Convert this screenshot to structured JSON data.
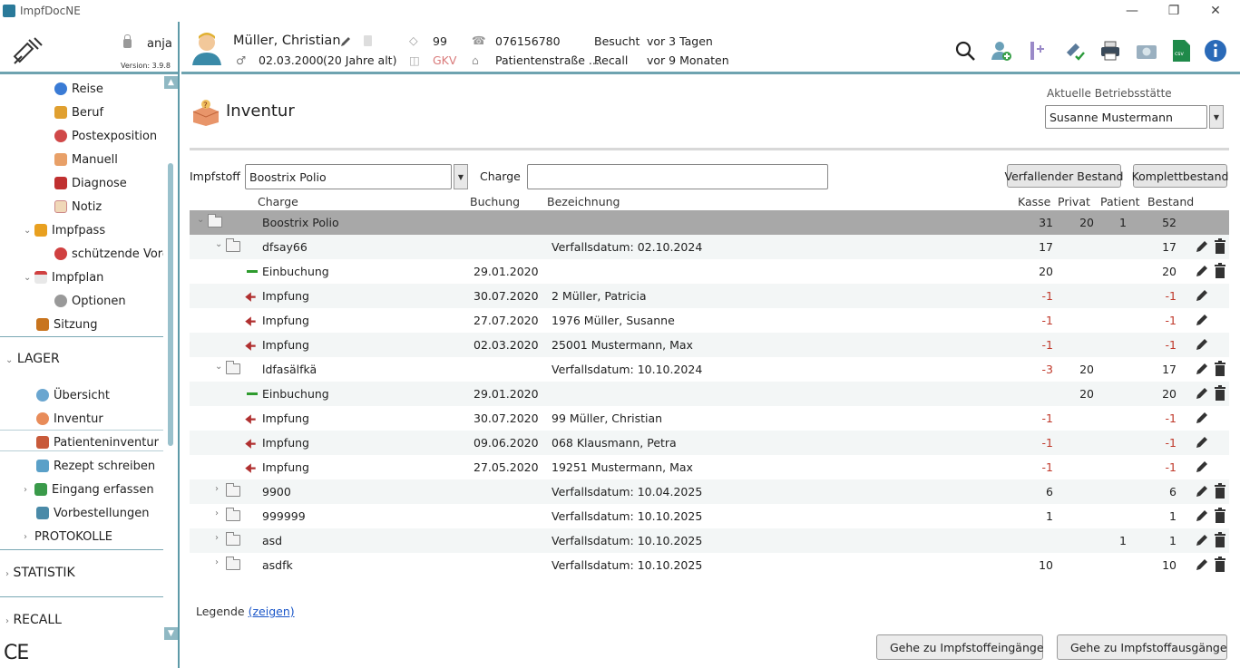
{
  "window": {
    "title": "ImpfDocNE"
  },
  "sidebar": {
    "user": "anja",
    "version": "Version: 3.9.8",
    "items": [
      {
        "label": "Reise",
        "icon": "globe-icon"
      },
      {
        "label": "Beruf",
        "icon": "tools-icon"
      },
      {
        "label": "Postexposition",
        "icon": "alert-icon"
      },
      {
        "label": "Manuell",
        "icon": "hand-icon"
      },
      {
        "label": "Diagnose",
        "icon": "book-icon"
      },
      {
        "label": "Notiz",
        "icon": "note-icon"
      },
      {
        "label": "Impfpass",
        "icon": "passport-icon"
      },
      {
        "label": "schützende Vorer",
        "icon": "heart-icon"
      },
      {
        "label": "Impfplan",
        "icon": "calendar-icon"
      },
      {
        "label": "Optionen",
        "icon": "gear-icon"
      },
      {
        "label": "Sitzung",
        "icon": "briefcase-icon"
      }
    ],
    "lager_label": "LAGER",
    "lager_items": [
      {
        "label": "Übersicht",
        "icon": "overview-icon"
      },
      {
        "label": "Inventur",
        "icon": "inventory-icon"
      },
      {
        "label": "Patienteninventur",
        "icon": "patients-icon"
      },
      {
        "label": "Rezept schreiben",
        "icon": "prescription-icon"
      },
      {
        "label": "Eingang erfassen",
        "icon": "inbox-icon"
      },
      {
        "label": "Vorbestellungen",
        "icon": "preorder-icon"
      }
    ],
    "protokolle_label": "PROTOKOLLE",
    "statistik_label": "STATISTIK",
    "recall_label": "RECALL",
    "ce_label": "CE"
  },
  "patient": {
    "name": "Müller, Christian",
    "birth": "02.03.2000",
    "age": "(20 Jahre alt)",
    "id": "99",
    "insurance": "GKV",
    "phone": "076156780",
    "address": "Patientenstraße ...",
    "besucht_label": "Besucht",
    "besucht_value": "vor 3 Tagen",
    "recall_label": "Recall",
    "recall_value": "vor 9 Monaten"
  },
  "page": {
    "title": "Inventur",
    "betriebsstaette_label": "Aktuelle Betriebsstätte",
    "betriebsstaette_value": "Susanne Mustermann"
  },
  "filters": {
    "impfstoff_label": "Impfstoff",
    "impfstoff_value": "Boostrix Polio",
    "charge_label": "Charge",
    "charge_value": "",
    "btn_verfallend": "Verfallender Bestand",
    "btn_komplett": "Komplettbestand"
  },
  "table": {
    "headers": {
      "charge": "Charge",
      "buchung": "Buchung",
      "bezeichnung": "Bezeichnung",
      "kasse": "Kasse",
      "privat": "Privat",
      "patient": "Patient",
      "bestand": "Bestand"
    },
    "rows": [
      {
        "kind": "group",
        "level": 0,
        "label": "Boostrix Polio",
        "buchung": "",
        "bez": "",
        "kasse": "31",
        "privat": "20",
        "patient": "1",
        "bestand": "52",
        "edit": false,
        "del": false
      },
      {
        "kind": "folder",
        "level": 1,
        "open": true,
        "label": "dfsay66",
        "buchung": "",
        "bez": "Verfallsdatum: 02.10.2024",
        "kasse": "17",
        "privat": "",
        "patient": "",
        "bestand": "17",
        "edit": true,
        "del": true
      },
      {
        "kind": "in",
        "level": 2,
        "label": "Einbuchung",
        "buchung": "29.01.2020",
        "bez": "",
        "kasse": "20",
        "privat": "",
        "patient": "",
        "bestand": "20",
        "edit": true,
        "del": true
      },
      {
        "kind": "out",
        "level": 2,
        "label": "Impfung",
        "buchung": "30.07.2020",
        "bez": "2 Müller, Patricia",
        "kasse": "-1",
        "privat": "",
        "patient": "",
        "bestand": "-1",
        "edit": true,
        "del": false
      },
      {
        "kind": "out",
        "level": 2,
        "label": "Impfung",
        "buchung": "27.07.2020",
        "bez": "1976 Müller, Susanne",
        "kasse": "-1",
        "privat": "",
        "patient": "",
        "bestand": "-1",
        "edit": true,
        "del": false
      },
      {
        "kind": "out",
        "level": 2,
        "label": "Impfung",
        "buchung": "02.03.2020",
        "bez": "25001 Mustermann, Max",
        "kasse": "-1",
        "privat": "",
        "patient": "",
        "bestand": "-1",
        "edit": true,
        "del": false
      },
      {
        "kind": "folder",
        "level": 1,
        "open": true,
        "label": "ldfasälfkä",
        "buchung": "",
        "bez": "Verfallsdatum: 10.10.2024",
        "kasse": "-3",
        "privat": "20",
        "patient": "",
        "bestand": "17",
        "edit": true,
        "del": true
      },
      {
        "kind": "in",
        "level": 2,
        "label": "Einbuchung",
        "buchung": "29.01.2020",
        "bez": "",
        "kasse": "",
        "privat": "20",
        "patient": "",
        "bestand": "20",
        "edit": true,
        "del": true
      },
      {
        "kind": "out",
        "level": 2,
        "label": "Impfung",
        "buchung": "30.07.2020",
        "bez": "99 Müller, Christian",
        "kasse": "-1",
        "privat": "",
        "patient": "",
        "bestand": "-1",
        "edit": true,
        "del": false
      },
      {
        "kind": "out",
        "level": 2,
        "label": "Impfung",
        "buchung": "09.06.2020",
        "bez": "068 Klausmann, Petra",
        "kasse": "-1",
        "privat": "",
        "patient": "",
        "bestand": "-1",
        "edit": true,
        "del": false
      },
      {
        "kind": "out",
        "level": 2,
        "label": "Impfung",
        "buchung": "27.05.2020",
        "bez": "19251 Mustermann, Max",
        "kasse": "-1",
        "privat": "",
        "patient": "",
        "bestand": "-1",
        "edit": true,
        "del": false
      },
      {
        "kind": "folder",
        "level": 1,
        "open": false,
        "label": "9900",
        "buchung": "",
        "bez": "Verfallsdatum: 10.04.2025",
        "kasse": "6",
        "privat": "",
        "patient": "",
        "bestand": "6",
        "edit": true,
        "del": true
      },
      {
        "kind": "folder",
        "level": 1,
        "open": false,
        "label": "999999",
        "buchung": "",
        "bez": "Verfallsdatum: 10.10.2025",
        "kasse": "1",
        "privat": "",
        "patient": "",
        "bestand": "1",
        "edit": true,
        "del": true
      },
      {
        "kind": "folder",
        "level": 1,
        "open": false,
        "label": "asd",
        "buchung": "",
        "bez": "Verfallsdatum: 10.10.2025",
        "kasse": "",
        "privat": "",
        "patient": "1",
        "bestand": "1",
        "edit": true,
        "del": true
      },
      {
        "kind": "folder",
        "level": 1,
        "open": false,
        "label": "asdfk",
        "buchung": "",
        "bez": "Verfallsdatum: 10.10.2025",
        "kasse": "10",
        "privat": "",
        "patient": "",
        "bestand": "10",
        "edit": true,
        "del": true
      }
    ]
  },
  "legend": {
    "label": "Legende",
    "link": "(zeigen)"
  },
  "footer": {
    "btn_eingaenge": "Gehe zu Impfstoffeingänge",
    "btn_ausgaenge": "Gehe zu Impfstoffausgänge"
  }
}
